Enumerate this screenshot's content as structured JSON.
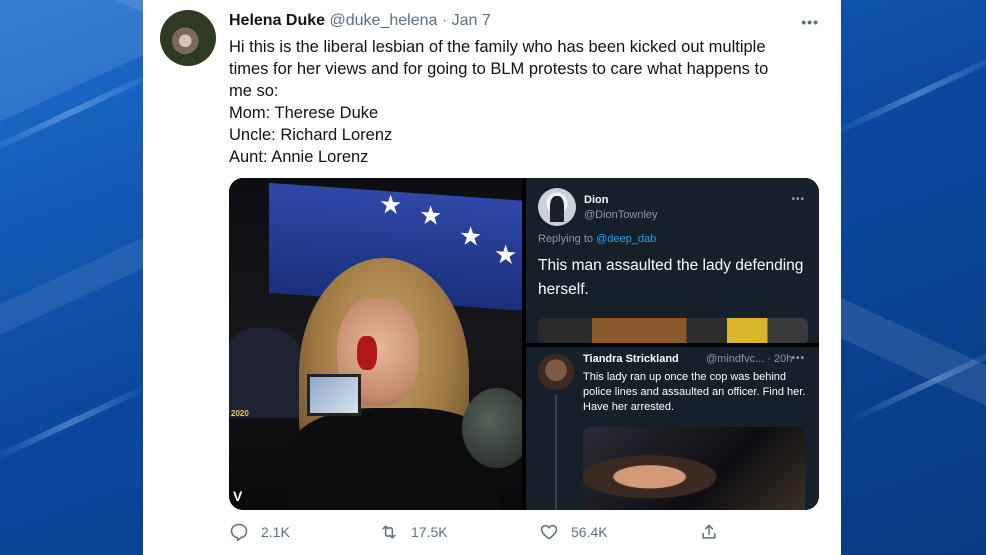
{
  "tweet": {
    "author_name": "Helena Duke",
    "author_handle": "@duke_helena",
    "separator": "·",
    "date": "Jan 7",
    "text_lines": [
      "Hi this is the liberal lesbian of the family who has been kicked out multiple",
      "times for her views and for going to BLM protests to care what happens to",
      "me so:",
      "Mom: Therese Duke",
      "Uncle: Richard Lorenz",
      "Aunt: Annie Lorenz"
    ],
    "actions": {
      "replies": "2.1K",
      "retweets": "17.5K",
      "likes": "56.4K"
    }
  },
  "media": {
    "photo_badge": "V",
    "hat_text": "2020",
    "screenshot_top": {
      "name": "Dion",
      "handle": "@DionTownley",
      "replying_to_prefix": "Replying to",
      "replying_to_handle": "@deep_dab",
      "text": "This man assaulted the lady defending herself."
    },
    "screenshot_bottom": {
      "name": "Tiandra Strickland",
      "handle": "@mindfvc... · 20h",
      "text": "This lady ran up once the cop was behind police lines and assaulted an officer. Find her. Have her arrested."
    }
  },
  "icons": {
    "more": "more-horizontal-icon",
    "reply": "reply-icon",
    "retweet": "retweet-icon",
    "like": "heart-icon",
    "share": "share-icon"
  },
  "colors": {
    "background": "#0b4aa0",
    "card": "#ffffff",
    "secondary_text": "#5b7083",
    "dark_card": "#15202b",
    "link": "#1da1f2"
  }
}
